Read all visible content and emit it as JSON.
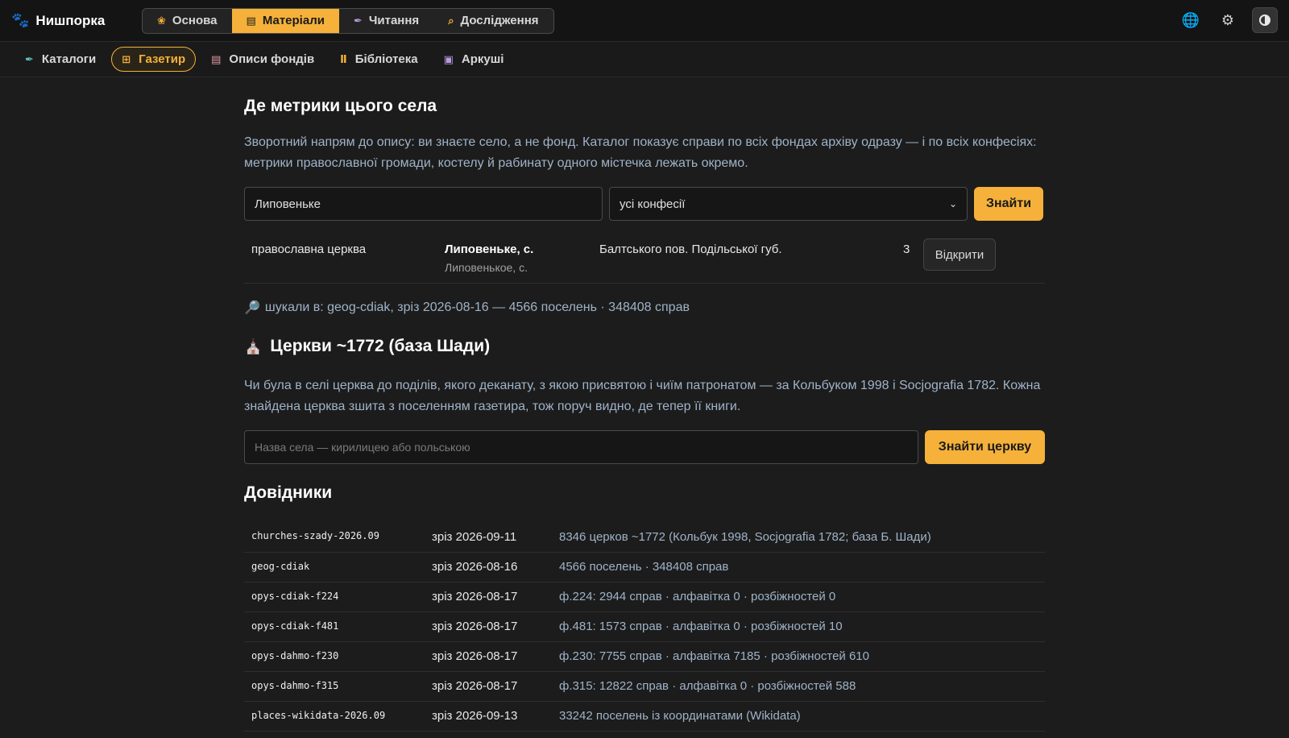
{
  "brand": {
    "name": "Нишпорка",
    "icon": "paw-icon"
  },
  "main_nav": [
    {
      "label": "Основа",
      "icon": "paw-icon",
      "active": false
    },
    {
      "label": "Матеріали",
      "icon": "archive-box-icon",
      "active": true
    },
    {
      "label": "Читання",
      "icon": "feather-icon",
      "active": false
    },
    {
      "label": "Дослідження",
      "icon": "magnifier-icon",
      "active": false
    }
  ],
  "top_right": {
    "globe": "globe-icon",
    "settings": "gear-icon",
    "theme": "contrast-icon"
  },
  "sub_nav": [
    {
      "label": "Каталоги",
      "icon": "quill-icon",
      "active": false
    },
    {
      "label": "Газетир",
      "icon": "grid-icon",
      "active": true
    },
    {
      "label": "Описи фондів",
      "icon": "archive-box-icon",
      "active": false
    },
    {
      "label": "Бібліотека",
      "icon": "books-icon",
      "active": false
    },
    {
      "label": "Аркуші",
      "icon": "image-icon",
      "active": false
    }
  ],
  "metryky": {
    "title": "Де метрики цього села",
    "description": "Зворотний напрям до опису: ви знаєте село, а не фонд. Каталог показує справи по всіх фондах архіву одразу — і по всіх конфесіях: метрики православної громади, костелу й рабинату одного містечка лежать окремо.",
    "place_value": "Липовеньке",
    "confession_value": "усі конфесії",
    "search_button": "Знайти",
    "result": {
      "confession": "православна церква",
      "village": "Липовеньке, с.",
      "village_ru": "Липовенькое, с.",
      "region": "Балтського пов. Подільської губ.",
      "count": "3",
      "open_button": "Відкрити"
    },
    "searched_in": "шукали в: geog-cdiak, зріз 2026-08-16 — 4566 поселень · 348408 справ"
  },
  "churches": {
    "title": "Церкви ~1772 (база Шади)",
    "description": "Чи була в селі церква до поділів, якого деканату, з якою присвятою і чиїм патронатом — за Кольбуком 1998 і Socjografia 1782. Кожна знайдена церква зшита з поселенням газетира, тож поруч видно, де тепер її книги.",
    "placeholder": "Назва села — кирилицею або польською",
    "search_button": "Знайти церкву"
  },
  "references": {
    "title": "Довідники",
    "rows": [
      {
        "id": "churches-szady-2026.09",
        "date": "зріз 2026-09-11",
        "desc": "8346 церков ~1772 (Кольбук 1998, Socjografia 1782; база Б. Шади)"
      },
      {
        "id": "geog-cdiak",
        "date": "зріз 2026-08-16",
        "desc": "4566 поселень · 348408 справ"
      },
      {
        "id": "opys-cdiak-f224",
        "date": "зріз 2026-08-17",
        "desc": "ф.224: 2944 справ · алфавітка 0 · розбіжностей 0"
      },
      {
        "id": "opys-cdiak-f481",
        "date": "зріз 2026-08-17",
        "desc": "ф.481: 1573 справ · алфавітка 0 · розбіжностей 10"
      },
      {
        "id": "opys-dahmo-f230",
        "date": "зріз 2026-08-17",
        "desc": "ф.230: 7755 справ · алфавітка 7185 · розбіжностей 610"
      },
      {
        "id": "opys-dahmo-f315",
        "date": "зріз 2026-08-17",
        "desc": "ф.315: 12822 справ · алфавітка 0 · розбіжностей 588"
      },
      {
        "id": "places-wikidata-2026.09",
        "date": "зріз 2026-09-13",
        "desc": "33242 поселень із координатами (Wikidata)"
      }
    ]
  }
}
